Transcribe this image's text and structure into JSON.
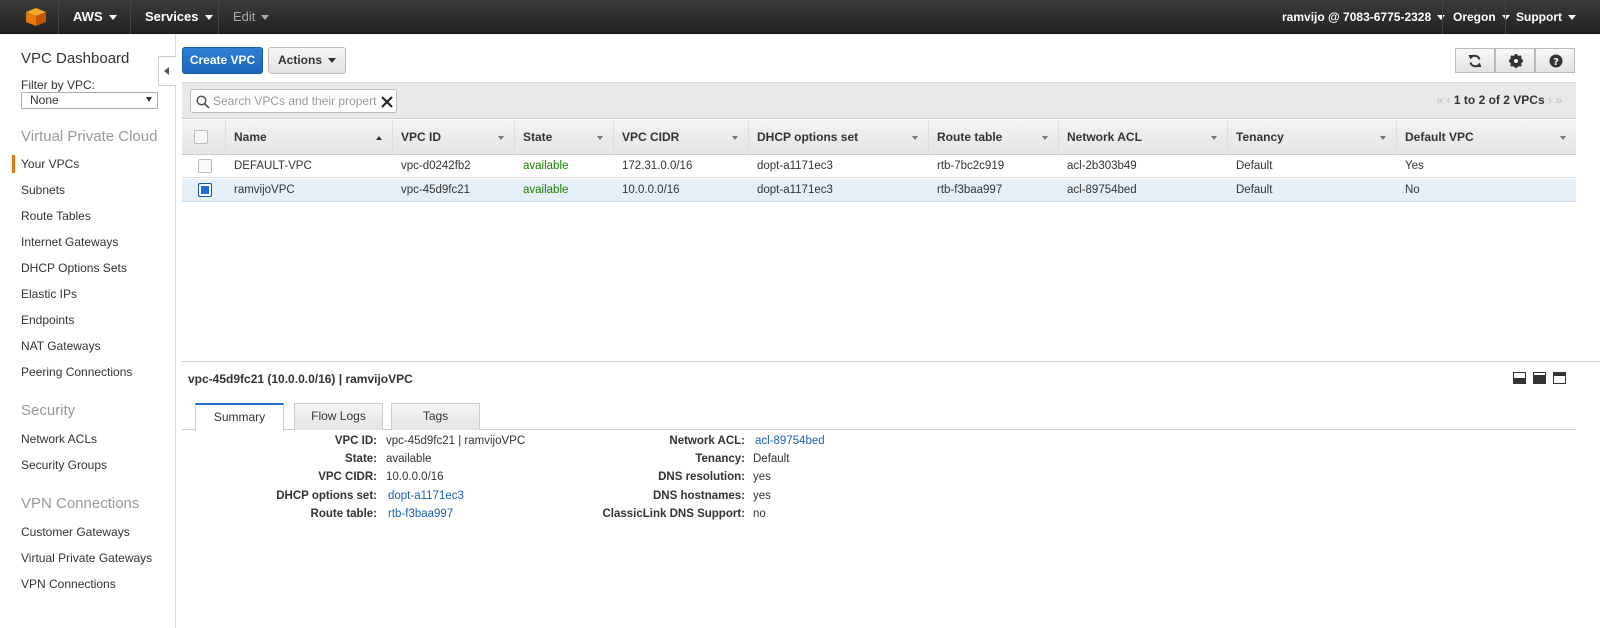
{
  "topnav": {
    "brand": "AWS",
    "services": "Services",
    "edit": "Edit",
    "account": "ramvijo @ 7083-6775-2328",
    "region": "Oregon",
    "support": "Support"
  },
  "sidebar": {
    "dashboard": "VPC Dashboard",
    "filter_label": "Filter by VPC:",
    "filter_value": "None",
    "sections": [
      {
        "title": "Virtual Private Cloud",
        "items": [
          "Your VPCs",
          "Subnets",
          "Route Tables",
          "Internet Gateways",
          "DHCP Options Sets",
          "Elastic IPs",
          "Endpoints",
          "NAT Gateways",
          "Peering Connections"
        ]
      },
      {
        "title": "Security",
        "items": [
          "Network ACLs",
          "Security Groups"
        ]
      },
      {
        "title": "VPN Connections",
        "items": [
          "Customer Gateways",
          "Virtual Private Gateways",
          "VPN Connections"
        ]
      }
    ],
    "active_item": "Your VPCs"
  },
  "toolbar": {
    "create_label": "Create VPC",
    "actions_label": "Actions",
    "icons": [
      "refresh-icon",
      "gear-icon",
      "help-icon"
    ]
  },
  "search": {
    "placeholder": "Search VPCs and their properties",
    "value": ""
  },
  "pager": {
    "text": "1 to 2 of 2 VPCs"
  },
  "table": {
    "columns": [
      "Name",
      "VPC ID",
      "State",
      "VPC CIDR",
      "DHCP options set",
      "Route table",
      "Network ACL",
      "Tenancy",
      "Default VPC"
    ],
    "rows": [
      {
        "name": "DEFAULT-VPC",
        "vpc_id": "vpc-d0242fb2",
        "state": "available",
        "cidr": "172.31.0.0/16",
        "dhcp": "dopt-a1171ec3",
        "route": "rtb-7bc2c919",
        "acl": "acl-2b303b49",
        "tenancy": "Default",
        "default": "Yes",
        "selected": false
      },
      {
        "name": "ramvijoVPC",
        "vpc_id": "vpc-45d9fc21",
        "state": "available",
        "cidr": "10.0.0.0/16",
        "dhcp": "dopt-a1171ec3",
        "route": "rtb-f3baa997",
        "acl": "acl-89754bed",
        "tenancy": "Default",
        "default": "No",
        "selected": true
      }
    ]
  },
  "detail": {
    "title": "vpc-45d9fc21 (10.0.0.0/16) | ramvijoVPC",
    "tabs": [
      "Summary",
      "Flow Logs",
      "Tags"
    ],
    "active_tab": "Summary",
    "left": [
      {
        "label": "VPC ID:",
        "value": "vpc-45d9fc21 | ramvijoVPC",
        "link": false
      },
      {
        "label": "State:",
        "value": "available",
        "link": false
      },
      {
        "label": "VPC CIDR:",
        "value": "10.0.0.0/16",
        "link": false
      },
      {
        "label": "DHCP options set:",
        "value": "dopt-a1171ec3",
        "link": true
      },
      {
        "label": "Route table:",
        "value": "rtb-f3baa997",
        "link": true
      }
    ],
    "right": [
      {
        "label": "Network ACL:",
        "value": "acl-89754bed",
        "link": true
      },
      {
        "label": "Tenancy:",
        "value": "Default",
        "link": false
      },
      {
        "label": "DNS resolution:",
        "value": "yes",
        "link": false
      },
      {
        "label": "DNS hostnames:",
        "value": "yes",
        "link": false
      },
      {
        "label": "ClassicLink DNS Support:",
        "value": "no",
        "link": false
      }
    ]
  },
  "colors": {
    "accent": "#ec7211",
    "primary": "#1f6fcf",
    "status_ok": "#1d8102",
    "link": "#1f5fb0"
  }
}
